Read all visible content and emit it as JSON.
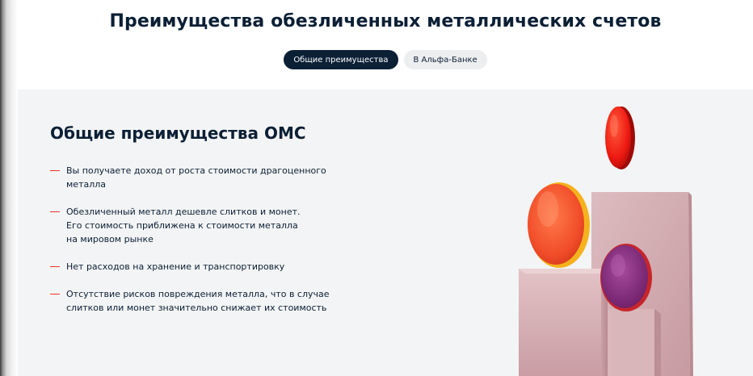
{
  "header": {
    "title": "Преимущества обезличенных металлических счетов",
    "tabs": [
      {
        "label": "Общие преимущества",
        "active": true
      },
      {
        "label": "В Альфа-Банке",
        "active": false
      }
    ]
  },
  "content": {
    "heading": "Общие преимущества ОМС",
    "benefits": [
      {
        "lines": [
          "Вы получаете доход от роста стоимости драгоценного",
          "металла"
        ]
      },
      {
        "lines": [
          "Обезличенный металл дешевле слитков и монет.",
          "Его стоимость приближена к стоимости металла",
          "на мировом рынке"
        ]
      },
      {
        "lines": [
          "Нет расходов на хранение и транспортировку"
        ]
      },
      {
        "lines": [
          "Отсутствие рисков повреждения металла, что в случае",
          "слитков или монет значительно снижает их стоимость"
        ]
      }
    ]
  },
  "colors": {
    "brand_dark": "#0b1f35",
    "accent_red": "#ef3124",
    "section_bg": "#f3f4f5",
    "tab_inactive_bg": "#edeef0"
  },
  "icons": {
    "list_bullet": "red-dash"
  }
}
